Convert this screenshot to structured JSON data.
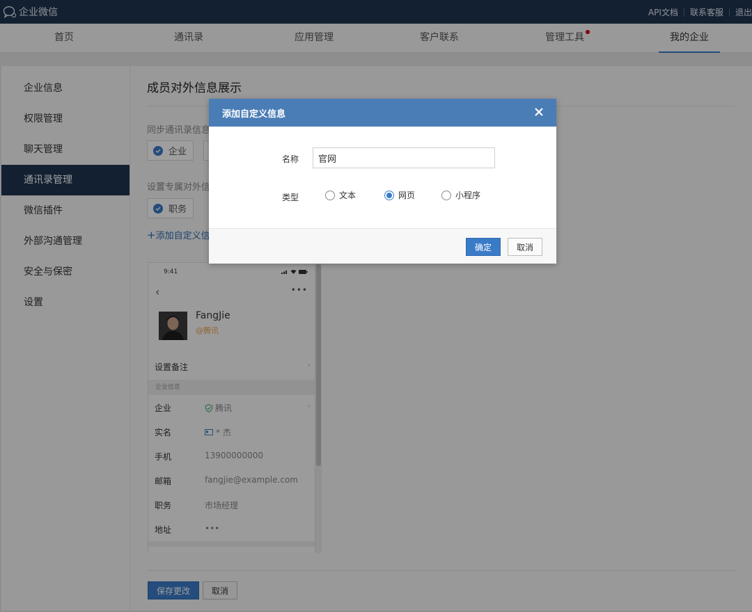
{
  "topbar": {
    "brand": "企业微信",
    "links": {
      "api_docs": "API文档",
      "support": "联系客服",
      "logout": "退出"
    }
  },
  "nav": {
    "items": [
      "首页",
      "通讯录",
      "应用管理",
      "客户联系",
      "管理工具",
      "我的企业"
    ],
    "active": "我的企业",
    "badge_on": "管理工具"
  },
  "sidebar": {
    "items": [
      "企业信息",
      "权限管理",
      "聊天管理",
      "通讯录管理",
      "微信插件",
      "外部沟通管理",
      "安全与保密",
      "设置"
    ],
    "active": "通讯录管理"
  },
  "main": {
    "title": "成员对外信息展示",
    "sync_label": "同步通讯录信息",
    "sync_chip": "企业",
    "custom_label": "设置专属对外信",
    "custom_chip": "职务",
    "add_link": "添加自定义信"
  },
  "phone": {
    "time": "9:41",
    "name": "FangJie",
    "corp": "@腾讯",
    "remark": "设置备注",
    "section": "企业信息",
    "rows": [
      {
        "label": "企业",
        "value": "腾讯"
      },
      {
        "label": "实名",
        "value": "* 杰"
      },
      {
        "label": "手机",
        "value": "13900000000"
      },
      {
        "label": "邮箱",
        "value": "fangjie@example.com"
      },
      {
        "label": "职务",
        "value": "市场经理"
      },
      {
        "label": "地址",
        "value": "•••"
      }
    ]
  },
  "footer": {
    "save": "保存更改",
    "cancel": "取消"
  },
  "dialog": {
    "title": "添加自定义信息",
    "name_label": "名称",
    "name_value": "官网",
    "type_label": "类型",
    "types": [
      "文本",
      "网页",
      "小程序"
    ],
    "selected_type": "网页",
    "confirm": "确定",
    "cancel": "取消"
  },
  "colors": {
    "topbar": "#1f3552",
    "accent": "#3a7bc8",
    "dialog_header": "#4a7db6",
    "badge": "#d0021b"
  }
}
